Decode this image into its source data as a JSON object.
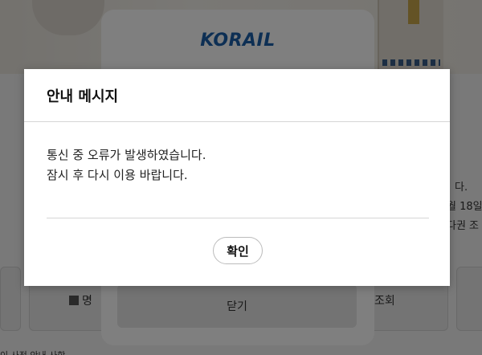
{
  "background": {
    "right_text_lines": [
      "다.",
      "월 18일",
      "다권 조"
    ],
    "left_button_label": "명",
    "right_button_label": "조회",
    "bottom_partial_text": "이 사전 안내 사항"
  },
  "korail_panel": {
    "logo_text": "KORAIL",
    "close_button_label": "닫기"
  },
  "dialog": {
    "title": "안내 메시지",
    "message_lines": [
      "통신 중 오류가 발생하였습니다.",
      "잠시 후 다시 이용 바랍니다."
    ],
    "confirm_label": "확인"
  },
  "colors": {
    "korail_brand": "#1a5ea8",
    "overlay": "rgba(0,0,0,0.5)"
  }
}
